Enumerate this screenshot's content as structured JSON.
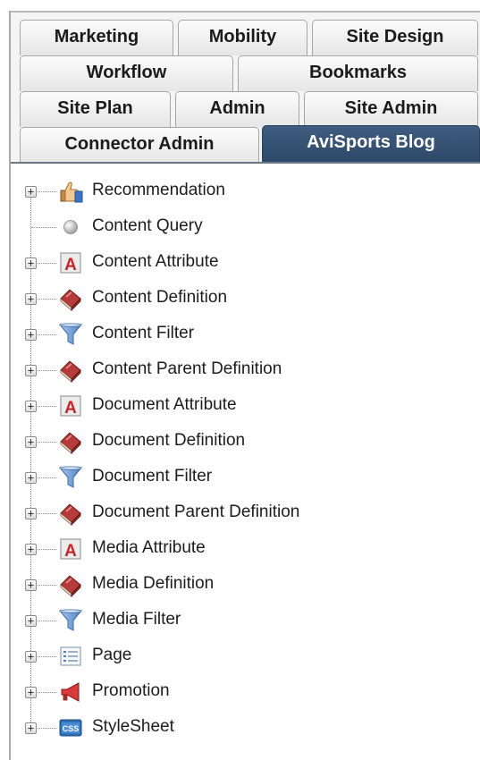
{
  "tabs": {
    "row1": [
      {
        "label": "Marketing",
        "name": "tab-marketing"
      },
      {
        "label": "Mobility",
        "name": "tab-mobility"
      },
      {
        "label": "Site Design",
        "name": "tab-site-design"
      }
    ],
    "row2": [
      {
        "label": "Workflow",
        "name": "tab-workflow"
      },
      {
        "label": "Bookmarks",
        "name": "tab-bookmarks"
      }
    ],
    "row3": [
      {
        "label": "Site Plan",
        "name": "tab-site-plan"
      },
      {
        "label": "Admin",
        "name": "tab-admin"
      },
      {
        "label": "Site Admin",
        "name": "tab-site-admin"
      }
    ],
    "row4": [
      {
        "label": "Connector Admin",
        "name": "tab-connector-admin"
      },
      {
        "label": "AviSports Blog",
        "name": "tab-avisports-blog",
        "active": true
      }
    ]
  },
  "tree": {
    "items": [
      {
        "label": "Recommendation",
        "icon": "thumbs-up-icon",
        "expandable": true
      },
      {
        "label": "Content Query",
        "icon": "sphere-icon",
        "expandable": false
      },
      {
        "label": "Content Attribute",
        "icon": "attribute-icon",
        "expandable": true
      },
      {
        "label": "Content Definition",
        "icon": "book-icon",
        "expandable": true
      },
      {
        "label": "Content Filter",
        "icon": "funnel-icon",
        "expandable": true
      },
      {
        "label": "Content Parent Definition",
        "icon": "book-icon",
        "expandable": true
      },
      {
        "label": "Document Attribute",
        "icon": "attribute-icon",
        "expandable": true
      },
      {
        "label": "Document Definition",
        "icon": "book-icon",
        "expandable": true
      },
      {
        "label": "Document Filter",
        "icon": "funnel-icon",
        "expandable": true
      },
      {
        "label": "Document Parent Definition",
        "icon": "book-icon",
        "expandable": true
      },
      {
        "label": "Media Attribute",
        "icon": "attribute-icon",
        "expandable": true
      },
      {
        "label": "Media Definition",
        "icon": "book-icon",
        "expandable": true
      },
      {
        "label": "Media Filter",
        "icon": "funnel-icon",
        "expandable": true
      },
      {
        "label": "Page",
        "icon": "page-icon",
        "expandable": true
      },
      {
        "label": "Promotion",
        "icon": "megaphone-icon",
        "expandable": true
      },
      {
        "label": "StyleSheet",
        "icon": "css-icon",
        "expandable": true
      }
    ]
  },
  "colors": {
    "active_tab": "#34506f",
    "tab_border": "#a6a6a6",
    "tree_text": "#1c1c1c"
  },
  "icons": {
    "css_text": "CSS",
    "attribute_letter": "A"
  }
}
